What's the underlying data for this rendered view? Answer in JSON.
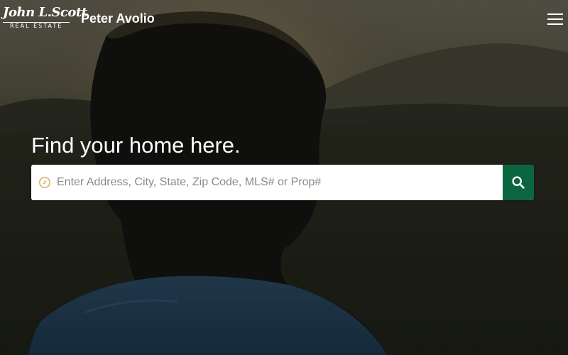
{
  "header": {
    "logo_line1": "John L.Scott",
    "logo_line2": "REAL ESTATE",
    "agent_name": "Peter Avolio",
    "menu_icon": "hamburger-menu-icon"
  },
  "hero": {
    "title": "Find your home here.",
    "search": {
      "placeholder": "Enter Address, City, State, Zip Code, MLS# or Prop#",
      "value": "",
      "location_icon": "compass-icon",
      "button_icon": "search-icon"
    }
  },
  "colors": {
    "brand_green": "#0b6640",
    "compass_gold": "#d8b45e",
    "text_white": "#ffffff",
    "placeholder_gray": "#8a8a8a"
  }
}
